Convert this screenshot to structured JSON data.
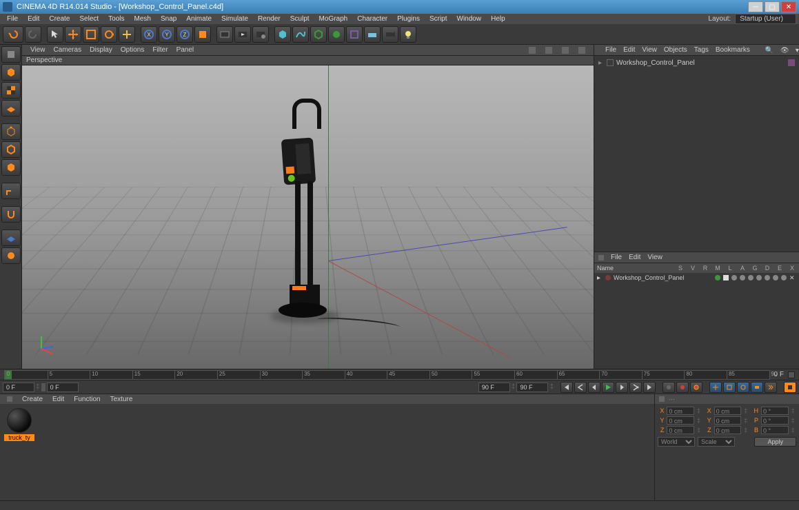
{
  "window": {
    "title": "CINEMA 4D R14.014 Studio - [Workshop_Control_Panel.c4d]"
  },
  "menu": {
    "items": [
      "File",
      "Edit",
      "Create",
      "Select",
      "Tools",
      "Mesh",
      "Snap",
      "Animate",
      "Simulate",
      "Render",
      "Sculpt",
      "MoGraph",
      "Character",
      "Plugins",
      "Script",
      "Window",
      "Help"
    ],
    "layout_label": "Layout:",
    "layout_value": "Startup (User)"
  },
  "viewport": {
    "menu": [
      "View",
      "Cameras",
      "Display",
      "Options",
      "Filter",
      "Panel"
    ],
    "label": "Perspective"
  },
  "objects_panel": {
    "menu": [
      "File",
      "Edit",
      "View",
      "Objects",
      "Tags",
      "Bookmarks"
    ],
    "root": "Workshop_Control_Panel"
  },
  "attr_panel": {
    "menu": [
      "File",
      "Edit",
      "View"
    ],
    "columns": [
      "S",
      "V",
      "R",
      "M",
      "L",
      "A",
      "G",
      "D",
      "E",
      "X"
    ],
    "name_label": "Name",
    "row_name": "Workshop_Control_Panel"
  },
  "timeline": {
    "ticks": [
      "0",
      "5",
      "10",
      "15",
      "20",
      "25",
      "30",
      "35",
      "40",
      "45",
      "50",
      "55",
      "60",
      "65",
      "70",
      "75",
      "80",
      "85",
      "90"
    ],
    "end_label": "0 F",
    "start_field": "0 F",
    "cur_field": "0 F",
    "range_in": "90 F",
    "range_out": "90 F"
  },
  "material_panel": {
    "menu": [
      "Create",
      "Edit",
      "Function",
      "Texture"
    ],
    "thumb_label": "truck_ty"
  },
  "coord_panel": {
    "rows": [
      {
        "ax": "X",
        "pos": "0 cm",
        "ax2": "X",
        "size": "0 cm",
        "rk": "H",
        "rot": "0 °"
      },
      {
        "ax": "Y",
        "pos": "0 cm",
        "ax2": "Y",
        "size": "0 cm",
        "rk": "P",
        "rot": "0 °"
      },
      {
        "ax": "Z",
        "pos": "0 cm",
        "ax2": "Z",
        "size": "0 cm",
        "rk": "B",
        "rot": "0 °"
      }
    ],
    "mode1": "World",
    "mode2": "Scale",
    "apply": "Apply"
  }
}
